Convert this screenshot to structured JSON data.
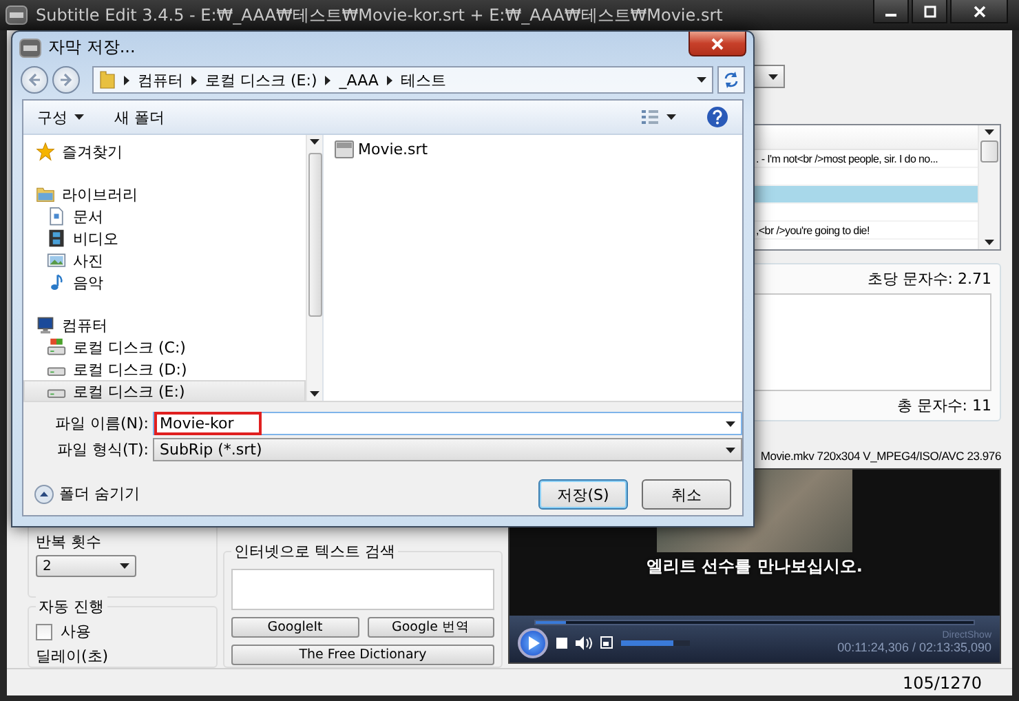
{
  "window": {
    "title": "Subtitle Edit 3.4.5 - E:₩_AAA₩테스트₩Movie-kor.srt + E:₩_AAA₩테스트₩Movie.srt"
  },
  "subtitle_list": {
    "rows": [
      {
        "text": ". - I'm not<br />most people, sir. I do no...",
        "selected": false
      },
      {
        "selected": false
      },
      {
        "selected": true
      },
      {
        "selected": false
      },
      {
        "text": ",<br />you're going to die!",
        "selected": false
      }
    ]
  },
  "text_panel": {
    "chars_per_sec": "초당 문자수: 2.71",
    "total_chars": "총 문자수: 11"
  },
  "repeat": {
    "label": "반복 횟수",
    "value": "2"
  },
  "auto_advance": {
    "title": "자동 진행",
    "checkbox": {
      "label": "사용",
      "checked": false
    },
    "delay_label": "딜레이(초)"
  },
  "web_search": {
    "title": "인터넷으로 텍스트 검색",
    "buttons": [
      "GoogleIt",
      "Google 번역",
      "The Free Dictionary"
    ]
  },
  "video": {
    "info": "Movie.mkv 720x304 V_MPEG4/ISO/AVC 23.976",
    "subtitle": "엘리트 선수를 만나보십시오.",
    "progress": {
      "level": 0.07
    },
    "volume": {
      "level": 0.75
    },
    "time": "00:11:24,306 / 02:13:35,090",
    "renderer": "DirectShow"
  },
  "status_bar": {
    "position": "105/1270"
  },
  "dialog": {
    "title": "자막 저장...",
    "breadcrumb": [
      "컴퓨터",
      "로컬 디스크 (E:)",
      "_AAA",
      "테스트"
    ],
    "toolbar": [
      {
        "label": "구성",
        "dropdown": true
      },
      {
        "label": "새 폴더",
        "dropdown": false
      }
    ],
    "nav": [
      {
        "label": "즐겨찾기",
        "kind": "favorites",
        "selected": false
      },
      {
        "label": "라이브러리",
        "kind": "library",
        "selected": false,
        "children": [
          {
            "label": "문서",
            "kind": "documents",
            "selected": false
          },
          {
            "label": "비디오",
            "kind": "videos",
            "selected": false
          },
          {
            "label": "사진",
            "kind": "pictures",
            "selected": false
          },
          {
            "label": "음악",
            "kind": "music",
            "selected": false
          }
        ]
      },
      {
        "label": "컴퓨터",
        "kind": "computer",
        "selected": false,
        "children": [
          {
            "label": "로컬 디스크 (C:)",
            "kind": "system_drive",
            "selected": false
          },
          {
            "label": "로컬 디스크 (D:)",
            "kind": "drive",
            "selected": false
          },
          {
            "label": "로컬 디스크 (E:)",
            "kind": "drive",
            "selected": true
          }
        ]
      }
    ],
    "files": [
      {
        "name": "Movie.srt"
      }
    ],
    "file_name": {
      "label": "파일 이름(N):",
      "value": "Movie-kor",
      "highlighted": true
    },
    "file_type": {
      "label": "파일 형식(T):",
      "value": "SubRip (*.srt)"
    },
    "hide_folders": "폴더 숨기기",
    "buttons": [
      {
        "label": "저장(S)",
        "default": true
      },
      {
        "label": "취소",
        "default": false
      }
    ]
  }
}
